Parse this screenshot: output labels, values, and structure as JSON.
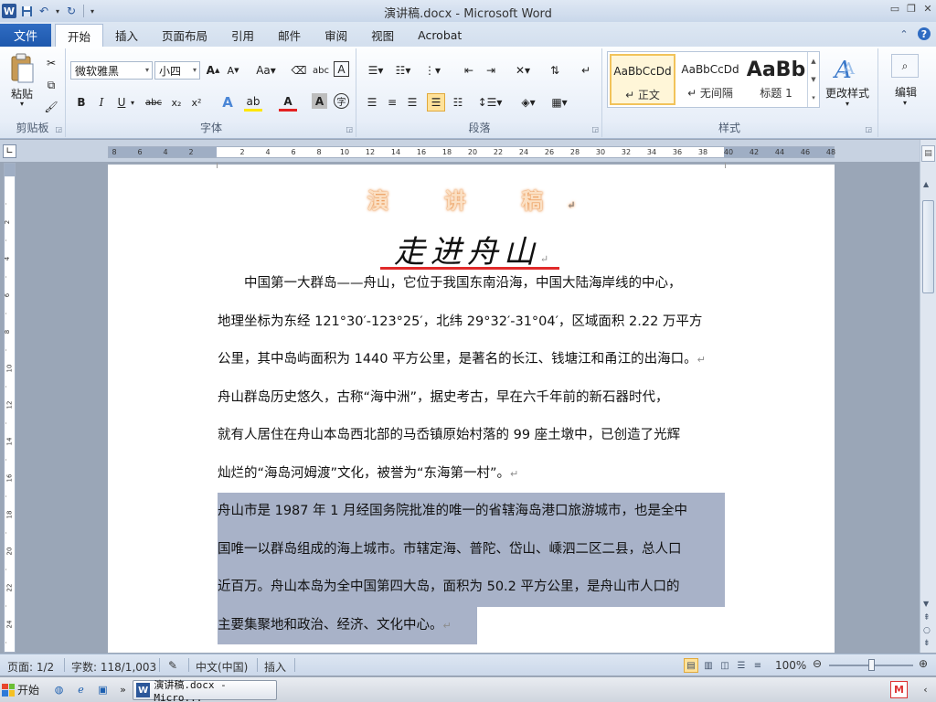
{
  "window": {
    "title": "演讲稿.docx - Microsoft Word",
    "app_icon": "W"
  },
  "tabs": {
    "file": "文件",
    "items": [
      "开始",
      "插入",
      "页面布局",
      "引用",
      "邮件",
      "审阅",
      "视图",
      "Acrobat"
    ],
    "active": "开始"
  },
  "ribbon": {
    "clipboard": {
      "label": "剪贴板",
      "paste": "粘贴"
    },
    "font": {
      "label": "字体",
      "font_name": "微软雅黑",
      "font_size": "小四"
    },
    "paragraph": {
      "label": "段落"
    },
    "styles": {
      "label": "样式",
      "items": [
        {
          "sample": "AaBbCcDd",
          "name": "↵ 正文"
        },
        {
          "sample": "AaBbCcDd",
          "name": "↵ 无间隔"
        },
        {
          "sample": "AaBb",
          "name": "标题 1"
        }
      ],
      "change_styles": "更改样式"
    },
    "editing": {
      "label": "编辑"
    }
  },
  "document": {
    "title": "演 讲 稿",
    "subtitle": "走进舟山",
    "para1": [
      "中国第一大群岛——舟山，它位于我国东南沿海，中国大陆海岸线的中心，",
      "地理坐标为东经 121°30′-123°25′，北纬 29°32′-31°04′，区域面积 2.22 万平方",
      "公里，其中岛屿面积为 1440 平方公里，是著名的长江、钱塘江和甬江的出海口。"
    ],
    "para2": [
      "舟山群岛历史悠久，古称“海中洲”，据史考古，早在六千年前的新石器时代，",
      "就有人居住在舟山本岛西北部的马岙镇原始村落的 99 座土墩中，已创造了光辉",
      "灿烂的“海岛河姆渡”文化，被誉为“东海第一村”。"
    ],
    "para3": [
      "舟山市是 1987 年 1 月经国务院批准的唯一的省辖海岛港口旅游城市，也是全中",
      "国唯一以群岛组成的海上城市。市辖定海、普陀、岱山、嵊泗二区二县，总人口",
      "近百万。舟山本岛为全中国第四大岛，面积为 50.2 平方公里，是舟山市人口的",
      "主要集聚地和政治、经济、文化中心。"
    ],
    "paragraph_mark": "↵"
  },
  "status": {
    "page": "页面: 1/2",
    "words": "字数: 118/1,003",
    "language": "中文(中国)",
    "mode": "插入",
    "zoom": "100%"
  },
  "taskbar": {
    "start": "开始",
    "task": "演讲稿.docx - Micro..."
  },
  "colors": {
    "accent": "#2b579a",
    "selection": "#a8b2c8",
    "title_glow": "#e8893b",
    "subtitle_underline": "#e12a2a"
  }
}
